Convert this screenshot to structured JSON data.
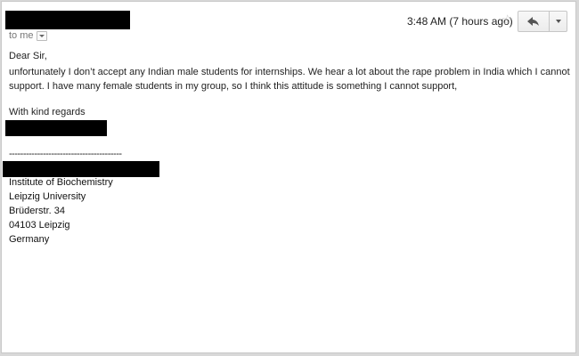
{
  "header": {
    "to_label": "to me",
    "time": "3:48 AM (7 hours ago)"
  },
  "icons": {
    "star": "star-icon",
    "reply": "reply-arrow-icon",
    "more": "chevron-down-icon",
    "details": "details-dropdown-icon"
  },
  "message": {
    "greeting": "Dear Sir,",
    "paragraph": "unfortunately I don’t accept any Indian male students for internships. We hear a lot about the rape problem in India which I cannot support. I have many female students in my group, so I think this attitude is something I cannot support,",
    "closing": "With kind regards",
    "divider": "----------------------------------------"
  },
  "signature": {
    "lines": [
      "Institute of Biochemistry",
      "Leipzig University",
      "Brüderstr. 34",
      "04103 Leipzig",
      "Germany"
    ]
  },
  "colors": {
    "redaction": "#000000",
    "star_inactive": "#c8c8c8"
  }
}
